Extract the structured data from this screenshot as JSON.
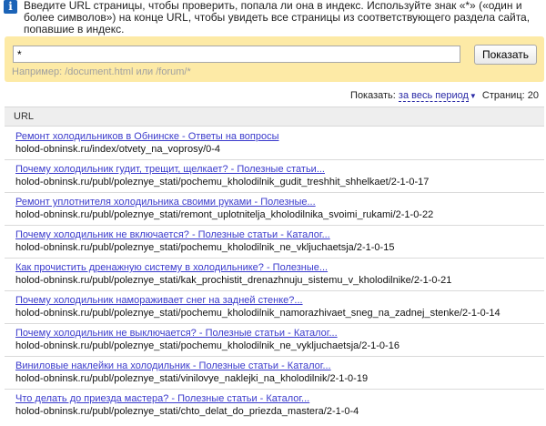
{
  "info": {
    "text": "Введите URL страницы, чтобы проверить, попала ли она в индекс. Используйте знак «*» («один и более символов») на конце URL, чтобы увидеть все страницы из соответствующего раздела сайта, попавшие в индекс."
  },
  "search": {
    "value": "*",
    "button_label": "Показать",
    "hint": "Например: /document.html или /forum/*"
  },
  "filter": {
    "show_label": "Показать:",
    "period_label": "за весь период",
    "pages_label": "Страниц:",
    "pages_count": "20"
  },
  "table": {
    "header": "URL"
  },
  "results": [
    {
      "title": "Ремонт холодильников в Обнинске - Ответы на вопросы",
      "url": "holod-obninsk.ru/index/otvety_na_voprosy/0-4"
    },
    {
      "title": "Почему холодильник гудит, трещит, щелкает? - Полезные статьи...",
      "url": "holod-obninsk.ru/publ/poleznye_stati/pochemu_kholodilnik_gudit_treshhit_shhelkaet/2-1-0-17"
    },
    {
      "title": "Ремонт уплотнителя холодильника своими руками - Полезные...",
      "url": "holod-obninsk.ru/publ/poleznye_stati/remont_uplotnitelja_kholodilnika_svoimi_rukami/2-1-0-22"
    },
    {
      "title": "Почему холодильник не включается? - Полезные статьи - Каталог...",
      "url": "holod-obninsk.ru/publ/poleznye_stati/pochemu_kholodilnik_ne_vkljuchaetsja/2-1-0-15"
    },
    {
      "title": "Как прочистить дренажную систему в холодильнике? - Полезные...",
      "url": "holod-obninsk.ru/publ/poleznye_stati/kak_prochistit_drenazhnuju_sistemu_v_kholodilnike/2-1-0-21"
    },
    {
      "title": "Почему холодильник намораживает снег на задней стенке?...",
      "url": "holod-obninsk.ru/publ/poleznye_stati/pochemu_kholodilnik_namorazhivaet_sneg_na_zadnej_stenke/2-1-0-14"
    },
    {
      "title": "Почему холодильник не выключается? - Полезные статьи - Каталог...",
      "url": "holod-obninsk.ru/publ/poleznye_stati/pochemu_kholodilnik_ne_vykljuchaetsja/2-1-0-16"
    },
    {
      "title": "Виниловые наклейки на холодильник - Полезные статьи - Каталог...",
      "url": "holod-obninsk.ru/publ/poleznye_stati/vinilovye_naklejki_na_kholodilnik/2-1-0-19"
    },
    {
      "title": "Что делать до приезда мастера? - Полезные статьи - Каталог...",
      "url": "holod-obninsk.ru/publ/poleznye_stati/chto_delat_do_priezda_mastera/2-1-0-4"
    }
  ]
}
